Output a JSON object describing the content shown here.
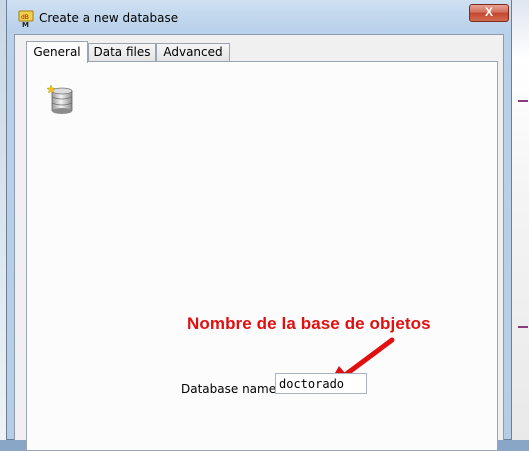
{
  "window": {
    "title": "Create a new database",
    "close_label": "X"
  },
  "tabs": [
    {
      "label": "General",
      "active": true
    },
    {
      "label": "Data files",
      "active": false
    },
    {
      "label": "Advanced",
      "active": false
    }
  ],
  "general": {
    "icon": "database-icon",
    "annotation": "Nombre de la base de objetos",
    "annotation_color": "#e01010",
    "database_name_label": "Database name:",
    "database_name_value": "doctorado"
  }
}
